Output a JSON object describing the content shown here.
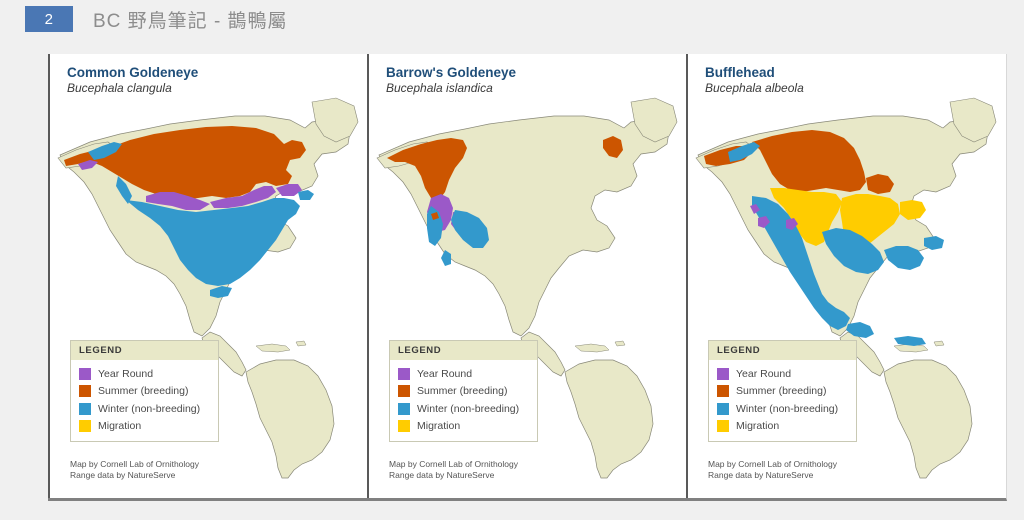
{
  "titlebar": {
    "slide_number": "2",
    "title": "BC 野鳥筆記 - 鵲鴨屬",
    "badge_color": "#4a77b4",
    "title_color": "#8d8d8d"
  },
  "colors": {
    "year_round": "#9B59C8",
    "summer": "#CC5500",
    "winter": "#3399CC",
    "migration": "#FFCC00",
    "land": "#e8e8c8",
    "land_border": "#888878",
    "ocean": "#ffffff",
    "heading": "#1f4e79"
  },
  "legend": {
    "title": "LEGEND",
    "items": [
      {
        "label": "Year Round",
        "color": "#9B59C8"
      },
      {
        "label": "Summer (breeding)",
        "color": "#CC5500"
      },
      {
        "label": "Winter (non-breeding)",
        "color": "#3399CC"
      },
      {
        "label": "Migration",
        "color": "#FFCC00"
      }
    ]
  },
  "credits": {
    "line1": "Map by Cornell Lab of Ornithology",
    "line2": "Range data by NatureServe"
  },
  "panels": [
    {
      "common_name": "Common Goldeneye",
      "scientific_name": "Bucephala clangula",
      "ranges": {
        "summer": "boreal Alaska and Canada across to Newfoundland",
        "winter": "most of contiguous United States and coastal strips",
        "year_round": "narrow band across southern Canada / Great Lakes",
        "migration": "none shown"
      }
    },
    {
      "common_name": "Barrow's Goldeneye",
      "scientific_name": "Bucephala islandica",
      "ranges": {
        "summer": "Alaska, Yukon, British Columbia, small area in Quebec/Labrador",
        "winter": "Pacific Northwest coast and inland Rockies",
        "year_round": "southern British Columbia and Washington",
        "migration": "none shown"
      }
    },
    {
      "common_name": "Bufflehead",
      "scientific_name": "Bucephala albeola",
      "ranges": {
        "summer": "Alaska, western and central Canada",
        "winter": "United States, Mexico coasts, southern Canada coasts",
        "year_round": "small spots in western United States",
        "migration": "central plains and eastern United States band"
      }
    }
  ]
}
